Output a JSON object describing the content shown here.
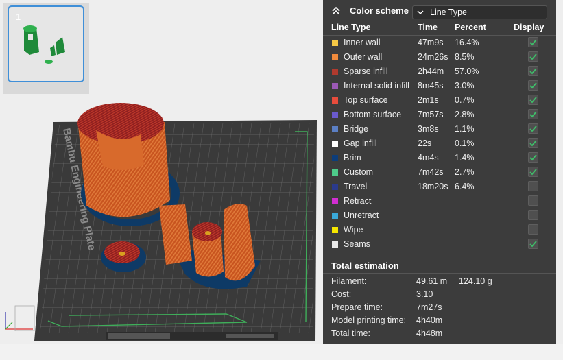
{
  "thumbnail": {
    "plate_number": "1"
  },
  "plate": {
    "brand_text": "Bambu Engineering Plate"
  },
  "color_scheme": {
    "title": "Color scheme",
    "selected": "Line Type",
    "columns": {
      "line_type": "Line Type",
      "time": "Time",
      "percent": "Percent",
      "display": "Display"
    },
    "rows": [
      {
        "name": "Inner wall",
        "time": "47m9s",
        "percent": "16.4%",
        "color": "#f5c845",
        "checked": true
      },
      {
        "name": "Outer wall",
        "time": "24m26s",
        "percent": "8.5%",
        "color": "#f08a3c",
        "checked": true
      },
      {
        "name": "Sparse infill",
        "time": "2h44m",
        "percent": "57.0%",
        "color": "#b03a2e",
        "checked": true
      },
      {
        "name": "Internal solid infill",
        "time": "8m45s",
        "percent": "3.0%",
        "color": "#9b59b6",
        "checked": true
      },
      {
        "name": "Top surface",
        "time": "2m1s",
        "percent": "0.7%",
        "color": "#e74c3c",
        "checked": true
      },
      {
        "name": "Bottom surface",
        "time": "7m57s",
        "percent": "2.8%",
        "color": "#6a5acd",
        "checked": true
      },
      {
        "name": "Bridge",
        "time": "3m8s",
        "percent": "1.1%",
        "color": "#5b7fc4",
        "checked": true
      },
      {
        "name": "Gap infill",
        "time": "22s",
        "percent": "0.1%",
        "color": "#ffffff",
        "checked": true
      },
      {
        "name": "Brim",
        "time": "4m4s",
        "percent": "1.4%",
        "color": "#0d3d7a",
        "checked": true
      },
      {
        "name": "Custom",
        "time": "7m42s",
        "percent": "2.7%",
        "color": "#4ecb8a",
        "checked": true
      },
      {
        "name": "Travel",
        "time": "18m20s",
        "percent": "6.4%",
        "color": "#2b3a8c",
        "checked": false
      },
      {
        "name": "Retract",
        "time": "",
        "percent": "",
        "color": "#d22ed2",
        "checked": false
      },
      {
        "name": "Unretract",
        "time": "",
        "percent": "",
        "color": "#3aa8d8",
        "checked": false
      },
      {
        "name": "Wipe",
        "time": "",
        "percent": "",
        "color": "#f5e600",
        "checked": false
      },
      {
        "name": "Seams",
        "time": "",
        "percent": "",
        "color": "#e8e8e8",
        "checked": true
      }
    ]
  },
  "total_estimation": {
    "title": "Total estimation",
    "items": [
      {
        "label": "Filament:",
        "value": "49.61 m",
        "value2": "124.10 g"
      },
      {
        "label": "Cost:",
        "value": "3.10",
        "value2": ""
      },
      {
        "label": "Prepare time:",
        "value": "7m27s",
        "value2": ""
      },
      {
        "label": "Model printing time:",
        "value": "4h40m",
        "value2": ""
      },
      {
        "label": "Total time:",
        "value": "4h48m",
        "value2": ""
      }
    ]
  }
}
